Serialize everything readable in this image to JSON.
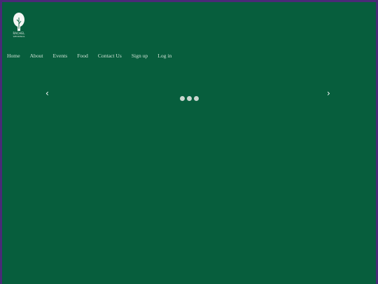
{
  "brand": {
    "name": "RACHEL",
    "tagline": "WEDDINGS"
  },
  "nav": {
    "items": [
      {
        "label": "Home"
      },
      {
        "label": "About"
      },
      {
        "label": "Events"
      },
      {
        "label": "Food"
      },
      {
        "label": "Contact Us"
      },
      {
        "label": "Sign up"
      },
      {
        "label": "Log in"
      }
    ]
  },
  "carousel": {
    "prev_icon": "‹",
    "next_icon": "›",
    "slide_count": 3
  },
  "colors": {
    "page_border": "#4a2a78",
    "background": "#075e3d",
    "nav_text": "#cfe3d6",
    "dot": "#c9d6ce"
  }
}
